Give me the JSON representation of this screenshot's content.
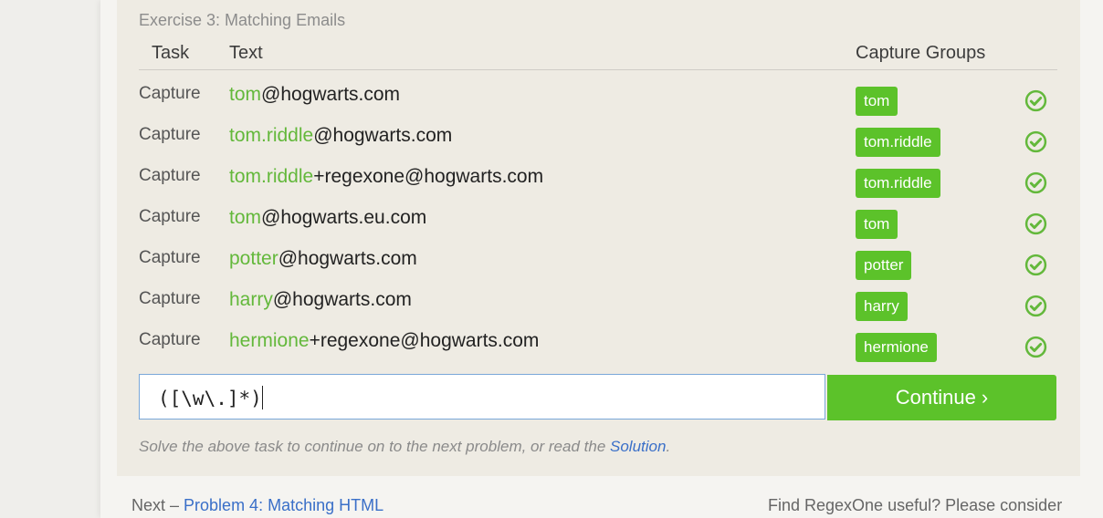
{
  "exercise": {
    "title": "Exercise 3: Matching Emails"
  },
  "table": {
    "headers": {
      "task": "Task",
      "text": "Text",
      "capture": "Capture Groups"
    },
    "rows": [
      {
        "task": "Capture",
        "group": "tom",
        "rest": "@hogwarts.com",
        "badge": "tom"
      },
      {
        "task": "Capture",
        "group": "tom.riddle",
        "rest": "@hogwarts.com",
        "badge": "tom.riddle"
      },
      {
        "task": "Capture",
        "group": "tom.riddle",
        "rest": "+regexone@hogwarts.com",
        "badge": "tom.riddle"
      },
      {
        "task": "Capture",
        "group": "tom",
        "rest": "@hogwarts.eu.com",
        "badge": "tom"
      },
      {
        "task": "Capture",
        "group": "potter",
        "rest": "@hogwarts.com",
        "badge": "potter"
      },
      {
        "task": "Capture",
        "group": "harry",
        "rest": "@hogwarts.com",
        "badge": "harry"
      },
      {
        "task": "Capture",
        "group": "hermione",
        "rest": "+regexone@hogwarts.com",
        "badge": "hermione"
      }
    ]
  },
  "input": {
    "value": "([\\w\\.]*)"
  },
  "continue_label": "Continue ›",
  "hint": {
    "prefix": "Solve the above task to continue on to the next problem, or read the ",
    "link": "Solution",
    "suffix": "."
  },
  "footer": {
    "next_prefix": "Next – ",
    "next_link": "Problem 4: Matching HTML",
    "find_text": "Find RegexOne useful? Please consider"
  },
  "colors": {
    "accent": "#5cc22a",
    "group_text": "#63b83b",
    "link": "#3a6fc8"
  },
  "icons": {
    "row_status": "check-circle-icon"
  }
}
